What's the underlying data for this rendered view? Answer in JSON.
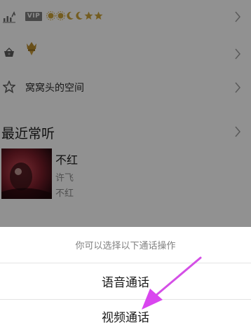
{
  "profile_rows": {
    "vip": {
      "badge": "VIP",
      "level_icons": [
        "sun-icon",
        "sun-icon",
        "moon-icon",
        "moon-icon",
        "star-icon",
        "star-icon"
      ]
    },
    "crown": {
      "icon": "crown-badge-icon"
    },
    "space": {
      "label": "窝窝头的空间"
    }
  },
  "recent": {
    "title": "最近常听",
    "song": {
      "title": "不红",
      "artist": "许飞",
      "album": "不红"
    }
  },
  "action_sheet": {
    "header": "你可以选择以下通话操作",
    "options": [
      {
        "label": "语音通话"
      },
      {
        "label": "视频通话"
      }
    ]
  },
  "colors": {
    "annotation_arrow": "#e040fb",
    "level_icon": "#e0b020"
  }
}
